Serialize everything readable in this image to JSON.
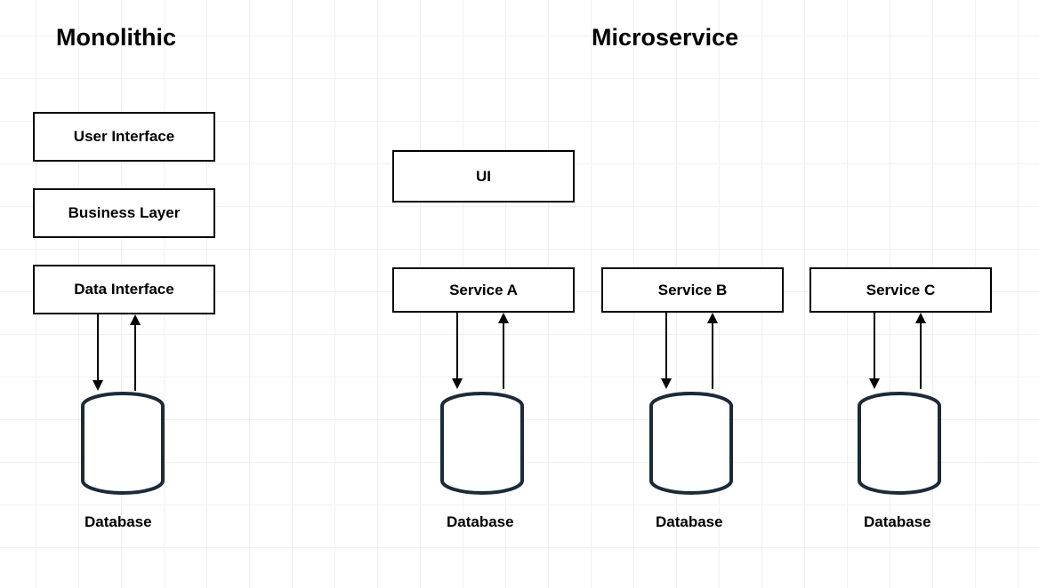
{
  "monolithic": {
    "title": "Monolithic",
    "boxes": {
      "ui": "User Interface",
      "business": "Business Layer",
      "data": "Data Interface"
    },
    "db_label": "Database"
  },
  "microservice": {
    "title": "Microservice",
    "ui_box": "UI",
    "services": [
      {
        "label": "Service A",
        "db_label": "Database"
      },
      {
        "label": "Service B",
        "db_label": "Database"
      },
      {
        "label": "Service C",
        "db_label": "Database"
      }
    ]
  }
}
